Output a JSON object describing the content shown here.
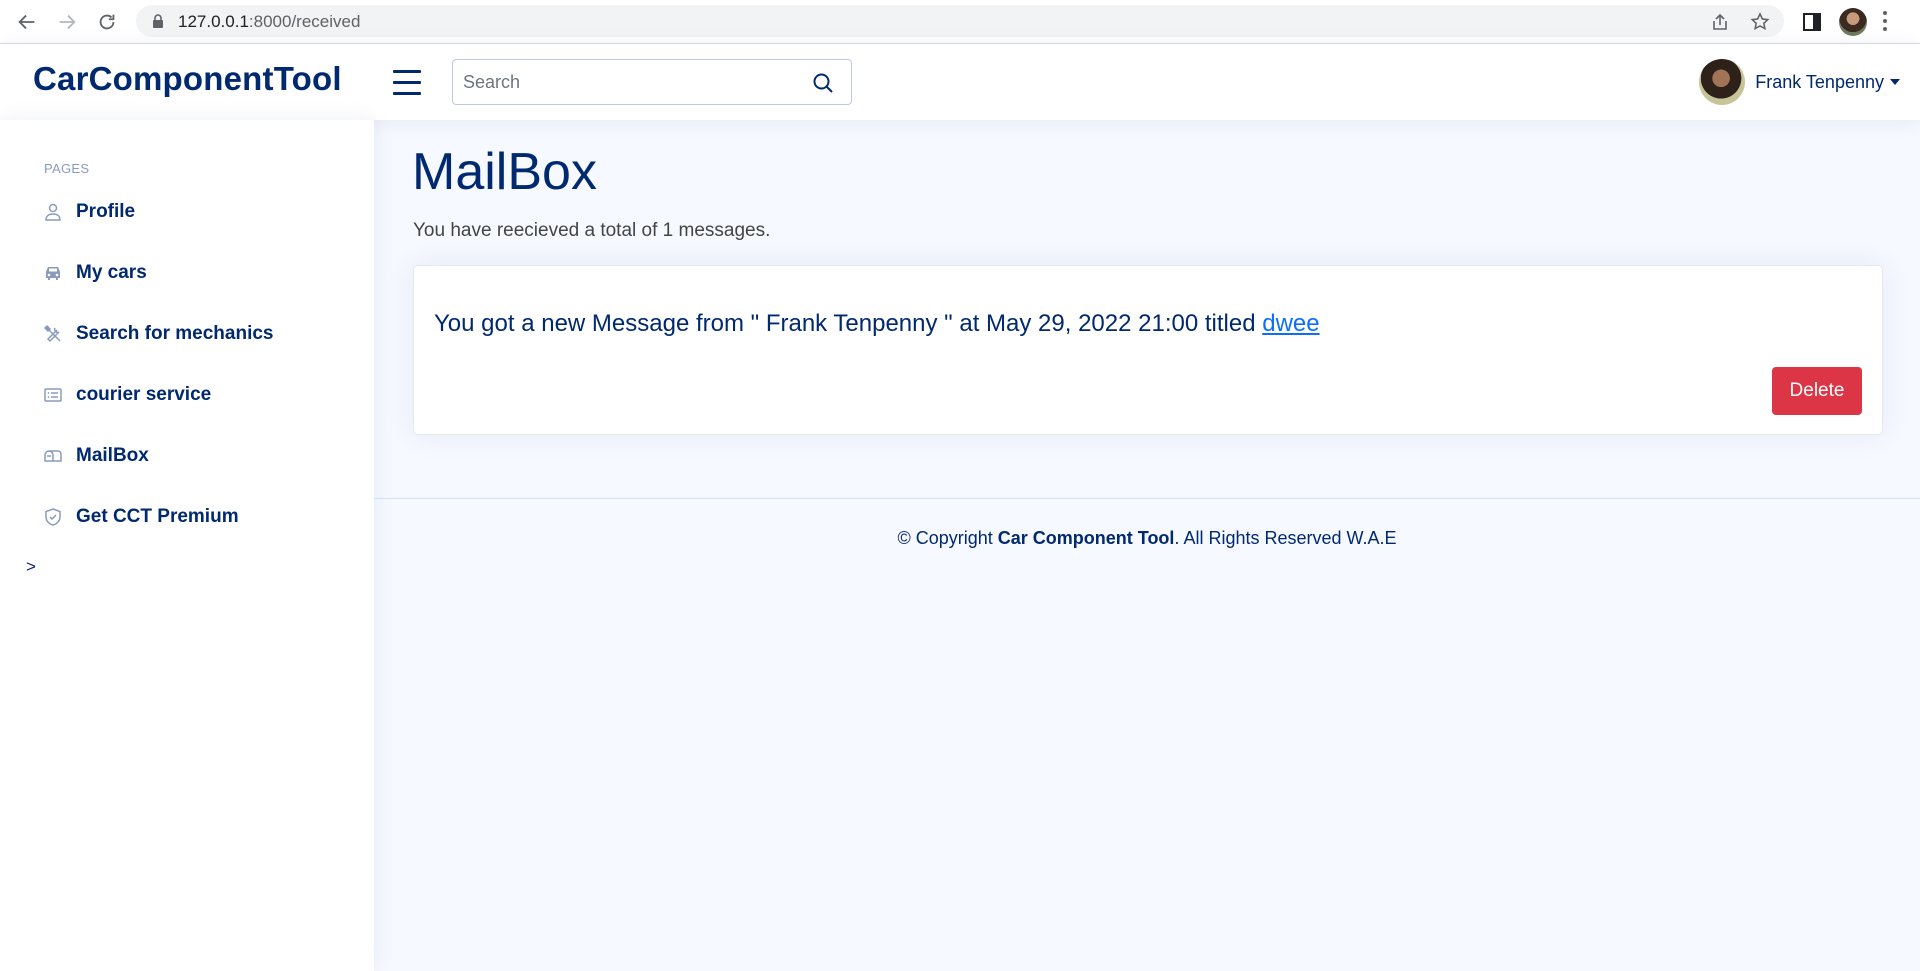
{
  "browser": {
    "url_host": "127.0.0.1",
    "url_rest": ":8000/received"
  },
  "header": {
    "logo": "CarComponentTool",
    "search_placeholder": "Search",
    "user_name": "Frank Tenpenny"
  },
  "sidebar": {
    "heading": "PAGES",
    "items": [
      {
        "label": "Profile",
        "icon": "person-icon"
      },
      {
        "label": "My cars",
        "icon": "car-icon"
      },
      {
        "label": "Search for mechanics",
        "icon": "tools-icon"
      },
      {
        "label": "courier service",
        "icon": "card-list-icon"
      },
      {
        "label": "MailBox",
        "icon": "mailbox-icon"
      },
      {
        "label": "Get CCT Premium",
        "icon": "shield-check-icon"
      }
    ],
    "toggle": ">"
  },
  "main": {
    "title": "MailBox",
    "summary": "You have reecieved a total of 1 messages.",
    "message": {
      "text": "You got a new Message from \" Frank Tenpenny \" at May 29, 2022 21:00 titled ",
      "link": "dwee",
      "delete_label": "Delete"
    }
  },
  "footer": {
    "prefix": "© Copyright ",
    "brand": "Car Component Tool",
    "suffix": ". All Rights Reserved W.A.E"
  },
  "colors": {
    "primary": "#012970",
    "danger": "#dc3545",
    "link": "#0d6efd",
    "background": "#f6f9ff"
  }
}
